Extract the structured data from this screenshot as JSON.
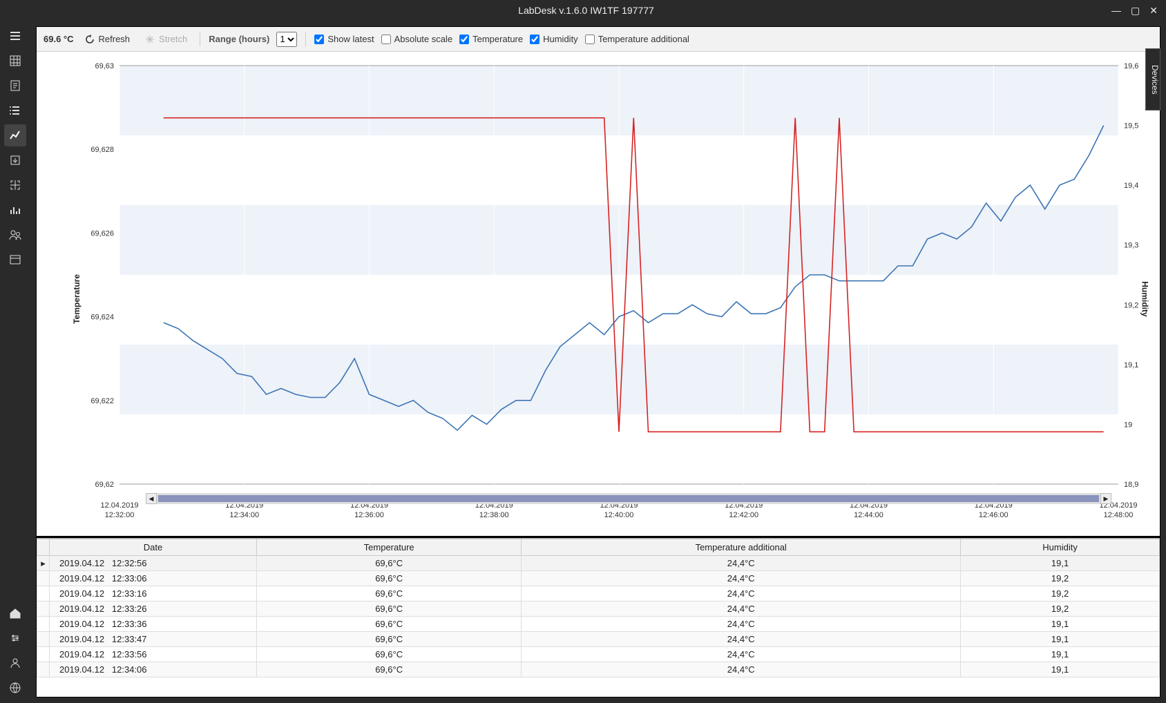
{
  "window": {
    "title": "LabDesk v.1.6.0 IW1TF 197777"
  },
  "toolbar": {
    "temp_reading": "69.6 °C",
    "refresh_label": "Refresh",
    "stretch_label": "Stretch",
    "range_label": "Range (hours)",
    "range_value": "1",
    "show_latest_label": "Show latest",
    "show_latest_checked": true,
    "absolute_scale_label": "Absolute scale",
    "absolute_scale_checked": false,
    "temperature_label": "Temperature",
    "temperature_checked": true,
    "humidity_label": "Humidity",
    "humidity_checked": true,
    "temperature_additional_label": "Temperature additional",
    "temperature_additional_checked": false
  },
  "chart": {
    "y_left_label": "Temperature",
    "y_right_label": "Humidity",
    "y_left_ticks": [
      "69,63",
      "69,628",
      "69,626",
      "69,624",
      "69,622",
      "69,62"
    ],
    "y_right_ticks": [
      "19,6",
      "19,5",
      "19,4",
      "19,3",
      "19,2",
      "19,1",
      "19",
      "18,9"
    ],
    "x_ticks_date": "12.04.2019",
    "x_ticks_time": [
      "12:32:00",
      "12:34:00",
      "12:36:00",
      "12:38:00",
      "12:40:00",
      "12:42:00",
      "12:44:00",
      "12:46:00",
      "12:48:00"
    ]
  },
  "chart_data": {
    "type": "line",
    "x": [
      "12:32:00",
      "12:34:00",
      "12:36:00",
      "12:38:00",
      "12:40:00",
      "12:42:00",
      "12:44:00",
      "12:46:00",
      "12:48:00"
    ],
    "x_range": [
      "2019-04-12 12:32:00",
      "2019-04-12 12:48:00"
    ],
    "series": [
      {
        "name": "Temperature",
        "axis": "left",
        "color": "#3b74b5",
        "ylabel": "Temperature",
        "ylim": [
          69.618,
          69.632
        ],
        "values": [
          69.6234,
          69.6232,
          69.6228,
          69.6225,
          69.6222,
          69.6217,
          69.6216,
          69.621,
          69.6212,
          69.621,
          69.6209,
          69.6209,
          69.6214,
          69.6222,
          69.621,
          69.6208,
          69.6206,
          69.6208,
          69.6204,
          69.6202,
          69.6198,
          69.6203,
          69.62,
          69.6205,
          69.6208,
          69.6208,
          69.6218,
          69.6226,
          69.623,
          69.6234,
          69.623,
          69.6236,
          69.6238,
          69.6234,
          69.6237,
          69.6237,
          69.624,
          69.6237,
          69.6236,
          69.6241,
          69.6237,
          69.6237,
          69.6239,
          69.6246,
          69.625,
          69.625,
          69.6248,
          69.6248,
          69.6248,
          69.6248,
          69.6253,
          69.6253,
          69.6262,
          69.6264,
          69.6262,
          69.6266,
          69.6274,
          69.6268,
          69.6276,
          69.628,
          69.6272,
          69.628,
          69.6282,
          69.629,
          69.63
        ]
      },
      {
        "name": "Humidity",
        "axis": "right",
        "color": "#d62222",
        "ylabel": "Humidity",
        "ylim": [
          18.85,
          19.65
        ],
        "values": [
          19.55,
          19.55,
          19.55,
          19.55,
          19.55,
          19.55,
          19.55,
          19.55,
          19.55,
          19.55,
          19.55,
          19.55,
          19.55,
          19.55,
          19.55,
          19.55,
          19.55,
          19.55,
          19.55,
          19.55,
          19.55,
          19.55,
          19.55,
          19.55,
          19.55,
          19.55,
          19.55,
          19.55,
          19.55,
          19.55,
          19.55,
          18.95,
          19.55,
          18.95,
          18.95,
          18.95,
          18.95,
          18.95,
          18.95,
          18.95,
          18.95,
          18.95,
          18.95,
          19.55,
          18.95,
          18.95,
          19.55,
          18.95,
          18.95,
          18.95,
          18.95,
          18.95,
          18.95,
          18.95,
          18.95,
          18.95,
          18.95,
          18.95,
          18.95,
          18.95,
          18.95,
          18.95,
          18.95,
          18.95,
          18.95
        ]
      }
    ]
  },
  "table": {
    "headers": [
      "Date",
      "Temperature",
      "Temperature additional",
      "Humidity"
    ],
    "rows": [
      {
        "date": "2019.04.12   12:32:56",
        "temperature": "69,6°C",
        "temperature_additional": "24,4°C",
        "humidity": "19,1",
        "selected": true
      },
      {
        "date": "2019.04.12   12:33:06",
        "temperature": "69,6°C",
        "temperature_additional": "24,4°C",
        "humidity": "19,2"
      },
      {
        "date": "2019.04.12   12:33:16",
        "temperature": "69,6°C",
        "temperature_additional": "24,4°C",
        "humidity": "19,2"
      },
      {
        "date": "2019.04.12   12:33:26",
        "temperature": "69,6°C",
        "temperature_additional": "24,4°C",
        "humidity": "19,2"
      },
      {
        "date": "2019.04.12   12:33:36",
        "temperature": "69,6°C",
        "temperature_additional": "24,4°C",
        "humidity": "19,1"
      },
      {
        "date": "2019.04.12   12:33:47",
        "temperature": "69,6°C",
        "temperature_additional": "24,4°C",
        "humidity": "19,1"
      },
      {
        "date": "2019.04.12   12:33:56",
        "temperature": "69,6°C",
        "temperature_additional": "24,4°C",
        "humidity": "19,1"
      },
      {
        "date": "2019.04.12   12:34:06",
        "temperature": "69,6°C",
        "temperature_additional": "24,4°C",
        "humidity": "19,1"
      }
    ]
  },
  "right_panel": {
    "label": "Devices"
  }
}
